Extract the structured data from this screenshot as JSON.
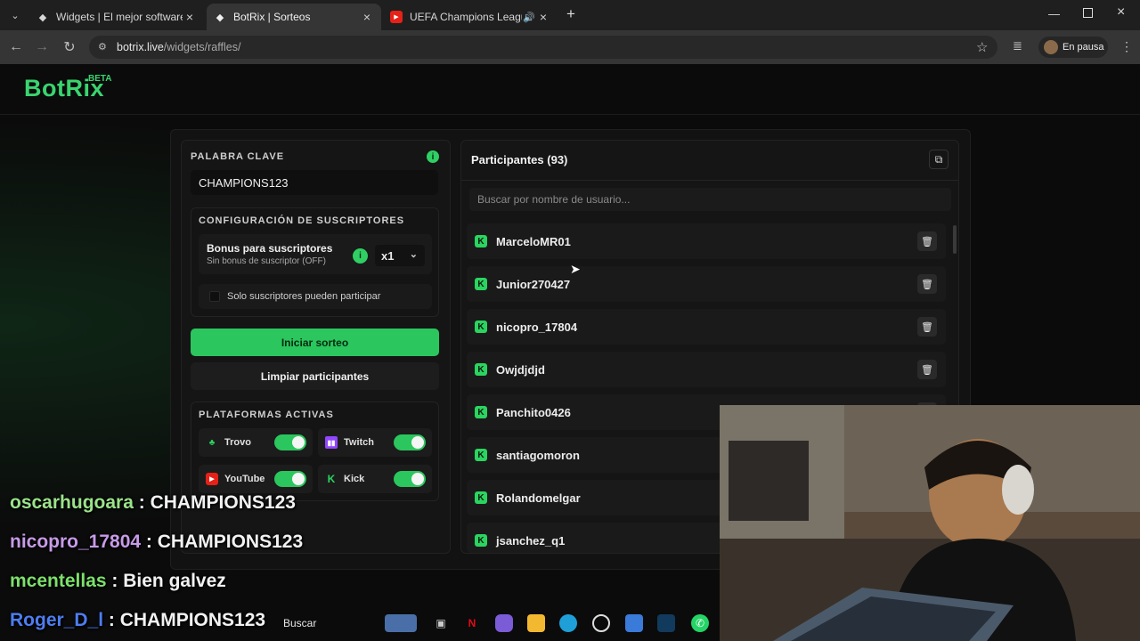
{
  "browser": {
    "tabs": [
      {
        "title": "Widgets | El mejor software par",
        "active": false
      },
      {
        "title": "BotRix | Sorteos",
        "active": true
      },
      {
        "title": "UEFA Champions League O",
        "active": false
      }
    ],
    "url_host": "botrix.live",
    "url_path": "/widgets/raffles/",
    "profile_label": "En pausa"
  },
  "app": {
    "logo": "BotRix",
    "beta": "BETA"
  },
  "left": {
    "keyword_title": "PALABRA CLAVE",
    "keyword_value": "CHAMPIONS123",
    "subs_title": "CONFIGURACIÓN DE SUSCRIPTORES",
    "bonus_title": "Bonus para suscriptores",
    "bonus_sub": "Sin bonus de suscriptor (OFF)",
    "multiplier": "x1",
    "solo_label": "Solo suscriptores pueden participar",
    "start_label": "Iniciar sorteo",
    "clear_label": "Limpiar participantes",
    "platforms_title": "PLATAFORMAS ACTIVAS",
    "platforms": [
      {
        "name": "Trovo",
        "icon": "trovo-icon",
        "enabled": true
      },
      {
        "name": "Twitch",
        "icon": "twitch-icon",
        "enabled": true
      },
      {
        "name": "YouTube",
        "icon": "youtube-icon",
        "enabled": true
      },
      {
        "name": "Kick",
        "icon": "kick-icon",
        "enabled": true
      }
    ]
  },
  "right": {
    "title": "Participantes (93)",
    "search_placeholder": "Buscar por nombre de usuario...",
    "participants": [
      "MarceloMR01",
      "Junior270427",
      "nicopro_17804",
      "Owjdjdjd",
      "Panchito0426",
      "santiagomoron",
      "Rolandomelgar",
      "jsanchez_q1"
    ]
  },
  "chat": [
    {
      "user": "oscarhugoara",
      "user_color": "#9be38a",
      "message": "CHAMPIONS123"
    },
    {
      "user": "nicopro_17804",
      "user_color": "#c79be8",
      "message": "CHAMPIONS123"
    },
    {
      "user": "mcentellas",
      "user_color": "#7de06b",
      "message": "Bien galvez"
    },
    {
      "user": "Roger_D_l",
      "user_color": "#4d7df0",
      "message": "CHAMPIONS123"
    }
  ],
  "taskbar": {
    "search_label": "Buscar"
  },
  "colors": {
    "accent": "#2bc65d",
    "background": "#0b0b0b"
  }
}
